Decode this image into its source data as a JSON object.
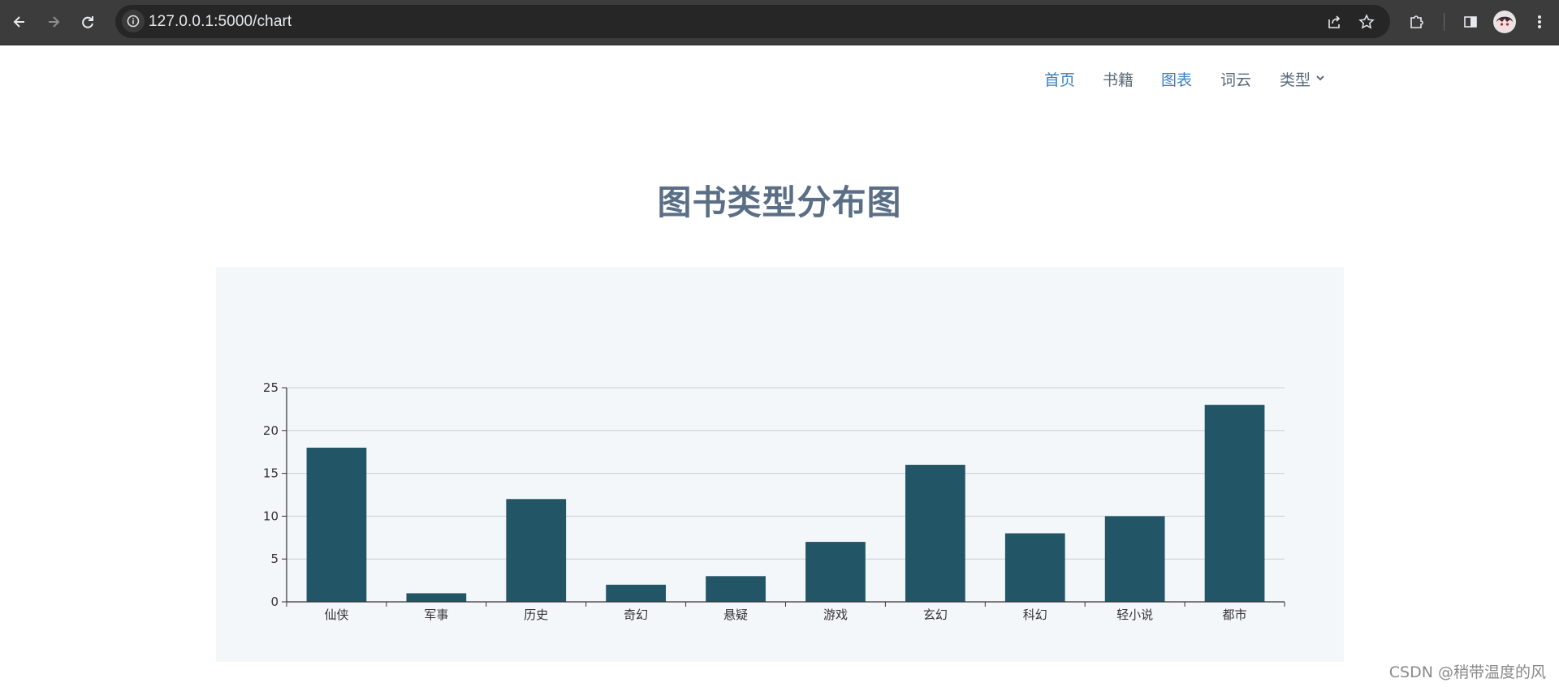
{
  "browser": {
    "url": "127.0.0.1:5000/chart",
    "icons": [
      "back-arrow-icon",
      "forward-arrow-icon",
      "reload-icon",
      "info-icon",
      "share-icon",
      "star-icon",
      "extensions-icon",
      "side-panel-icon",
      "profile-avatar",
      "more-menu-icon"
    ]
  },
  "nav": {
    "items": [
      {
        "label": "首页"
      },
      {
        "label": "书籍"
      },
      {
        "label": "图表"
      },
      {
        "label": "词云"
      },
      {
        "label": "类型"
      }
    ],
    "active_color": "#3d7fc1",
    "text_color": "#5a6b7a"
  },
  "page": {
    "title": "图书类型分布图",
    "watermark": "CSDN @稍带温度的风"
  },
  "chart_data": {
    "type": "bar",
    "categories": [
      "仙侠",
      "军事",
      "历史",
      "奇幻",
      "悬疑",
      "游戏",
      "玄幻",
      "科幻",
      "轻小说",
      "都市"
    ],
    "values": [
      18,
      1,
      12,
      2,
      3,
      7,
      16,
      8,
      10,
      23
    ],
    "yticks": [
      0,
      5,
      10,
      15,
      20,
      25
    ],
    "ylim": [
      0,
      25
    ],
    "grid": true,
    "bar_color": "#225565",
    "background": "#f4f7fa"
  }
}
